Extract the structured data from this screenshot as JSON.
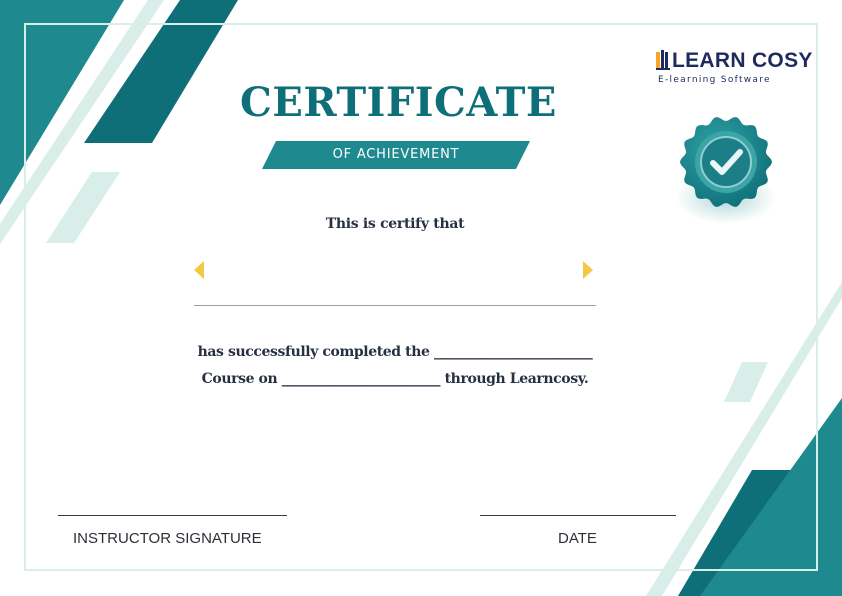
{
  "colors": {
    "teal_dark": "#0f6f78",
    "teal_mid": "#1e8a8f",
    "teal_pale": "#d9ede9",
    "gold": "#f5c842",
    "text_dark": "#263042",
    "logo_navy": "#1f2a5e"
  },
  "brand": {
    "name": "LEARN COSY",
    "tagline": "E-learning Software"
  },
  "certificate": {
    "title": "CERTIFICATE",
    "subtitle": "OF ACHIEVEMENT",
    "certify_text": "This is certify that",
    "body_line_1": "has successfully completed the ________________________",
    "body_line_2": "Course on ________________________ through Learncosy."
  },
  "badge": {
    "icon": "checkmark-seal-icon"
  },
  "signatures": {
    "instructor_label": "INSTRUCTOR SIGNATURE",
    "date_label": "DATE"
  }
}
